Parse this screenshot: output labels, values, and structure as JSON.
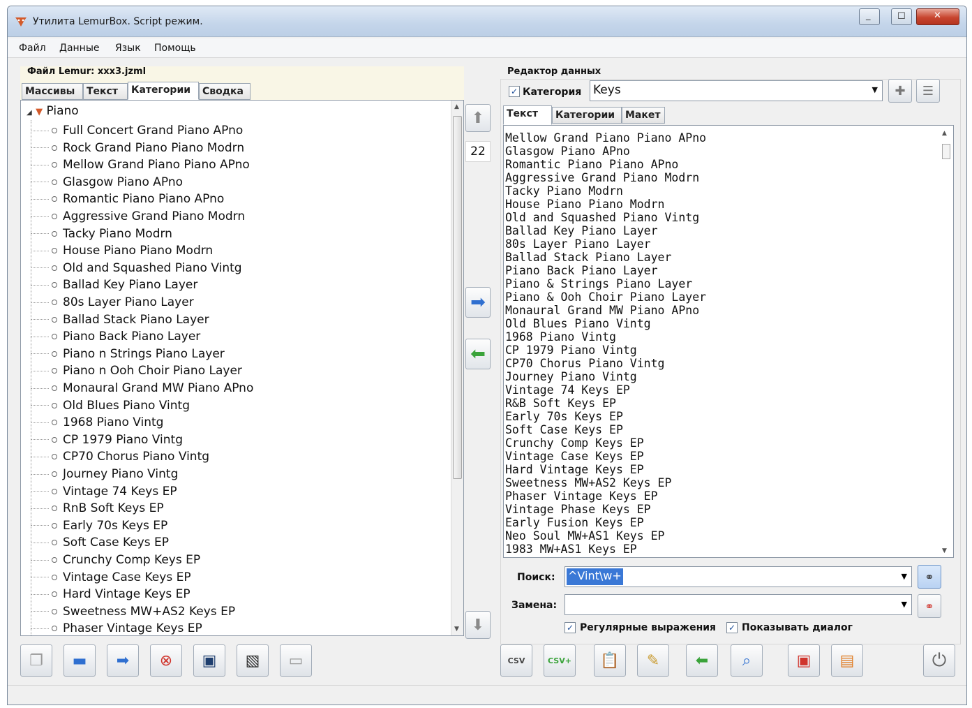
{
  "window": {
    "title": "Утилита LemurBox. Script режим."
  },
  "menu": [
    "Файл",
    "Данные",
    "Язык",
    "Помощь"
  ],
  "left_panel": {
    "file_label": "Файл Lemur: xxx3.jzml",
    "tabs": [
      "Массивы",
      "Текст",
      "Категории",
      "Сводка"
    ],
    "active_tab": "Категории",
    "tree_root": "Piano",
    "tree_items": [
      "Full Concert Grand Piano APno",
      "Rock Grand Piano Piano Modrn",
      "Mellow Grand Piano Piano APno",
      "Glasgow Piano APno",
      "Romantic Piano Piano APno",
      "Aggressive Grand Piano Modrn",
      "Tacky Piano Modrn",
      "House Piano Piano Modrn",
      "Old and Squashed Piano Vintg",
      "Ballad Key Piano Layer",
      "80s Layer Piano Layer",
      "Ballad Stack Piano Layer",
      "Piano Back Piano Layer",
      "Piano n Strings Piano Layer",
      "Piano n Ooh Choir Piano Layer",
      "Monaural Grand MW Piano APno",
      "Old Blues Piano Vintg",
      "1968 Piano Vintg",
      "CP 1979 Piano Vintg",
      "CP70 Chorus Piano Vintg",
      "Journey Piano Vintg",
      "Vintage 74 Keys EP",
      "RnB Soft Keys EP",
      "Early 70s Keys EP",
      "Soft Case Keys EP",
      "Crunchy Comp Keys EP",
      "Vintage Case Keys EP",
      "Hard Vintage Keys EP",
      "Sweetness MW+AS2 Keys EP",
      "Phaser Vintage Keys EP"
    ]
  },
  "middle": {
    "count": "22"
  },
  "right_panel": {
    "label": "Редактор данных",
    "category_checkbox_label": "Категория",
    "category_value": "Keys",
    "tabs": [
      "Текст",
      "Категории",
      "Макет"
    ],
    "active_tab": "Текст",
    "text_lines": [
      "Mellow Grand Piano Piano APno",
      "Glasgow Piano APno",
      "Romantic Piano Piano APno",
      "Aggressive Grand Piano Modrn",
      "Tacky Piano Modrn",
      "House Piano Piano Modrn",
      "Old and Squashed Piano Vintg",
      "Ballad Key Piano Layer",
      "80s Layer Piano Layer",
      "Ballad Stack Piano Layer",
      "Piano Back Piano Layer",
      "Piano & Strings Piano Layer",
      "Piano & Ooh Choir Piano Layer",
      "Monaural Grand MW Piano APno",
      "Old Blues Piano Vintg",
      "1968 Piano Vintg",
      "CP 1979 Piano Vintg",
      "CP70 Chorus Piano Vintg",
      "Journey Piano Vintg",
      "Vintage 74 Keys EP",
      "R&B Soft Keys EP",
      "Early 70s Keys EP",
      "Soft Case Keys EP",
      "Crunchy Comp Keys EP",
      "Vintage Case Keys EP",
      "Hard Vintage Keys EP",
      "Sweetness MW+AS2 Keys EP",
      "Phaser Vintage Keys EP",
      "Vintage Phase Keys EP",
      "Early Fusion Keys EP",
      "Neo Soul MW+AS1 Keys EP",
      "1983 MW+AS1 Keys EP"
    ],
    "search_label": "Поиск:",
    "search_value": "^Vint\\w+",
    "replace_label": "Замена:",
    "replace_value": "",
    "regex_label": "Регулярные выражения",
    "regex_checked": true,
    "show_dialog_label": "Показывать диалог",
    "show_dialog_checked": true
  },
  "colors": {
    "selection": "#3a78d6",
    "accent_blue": "#2f6fd0",
    "accent_green": "#3aa33a",
    "accent_red": "#d0342c"
  }
}
